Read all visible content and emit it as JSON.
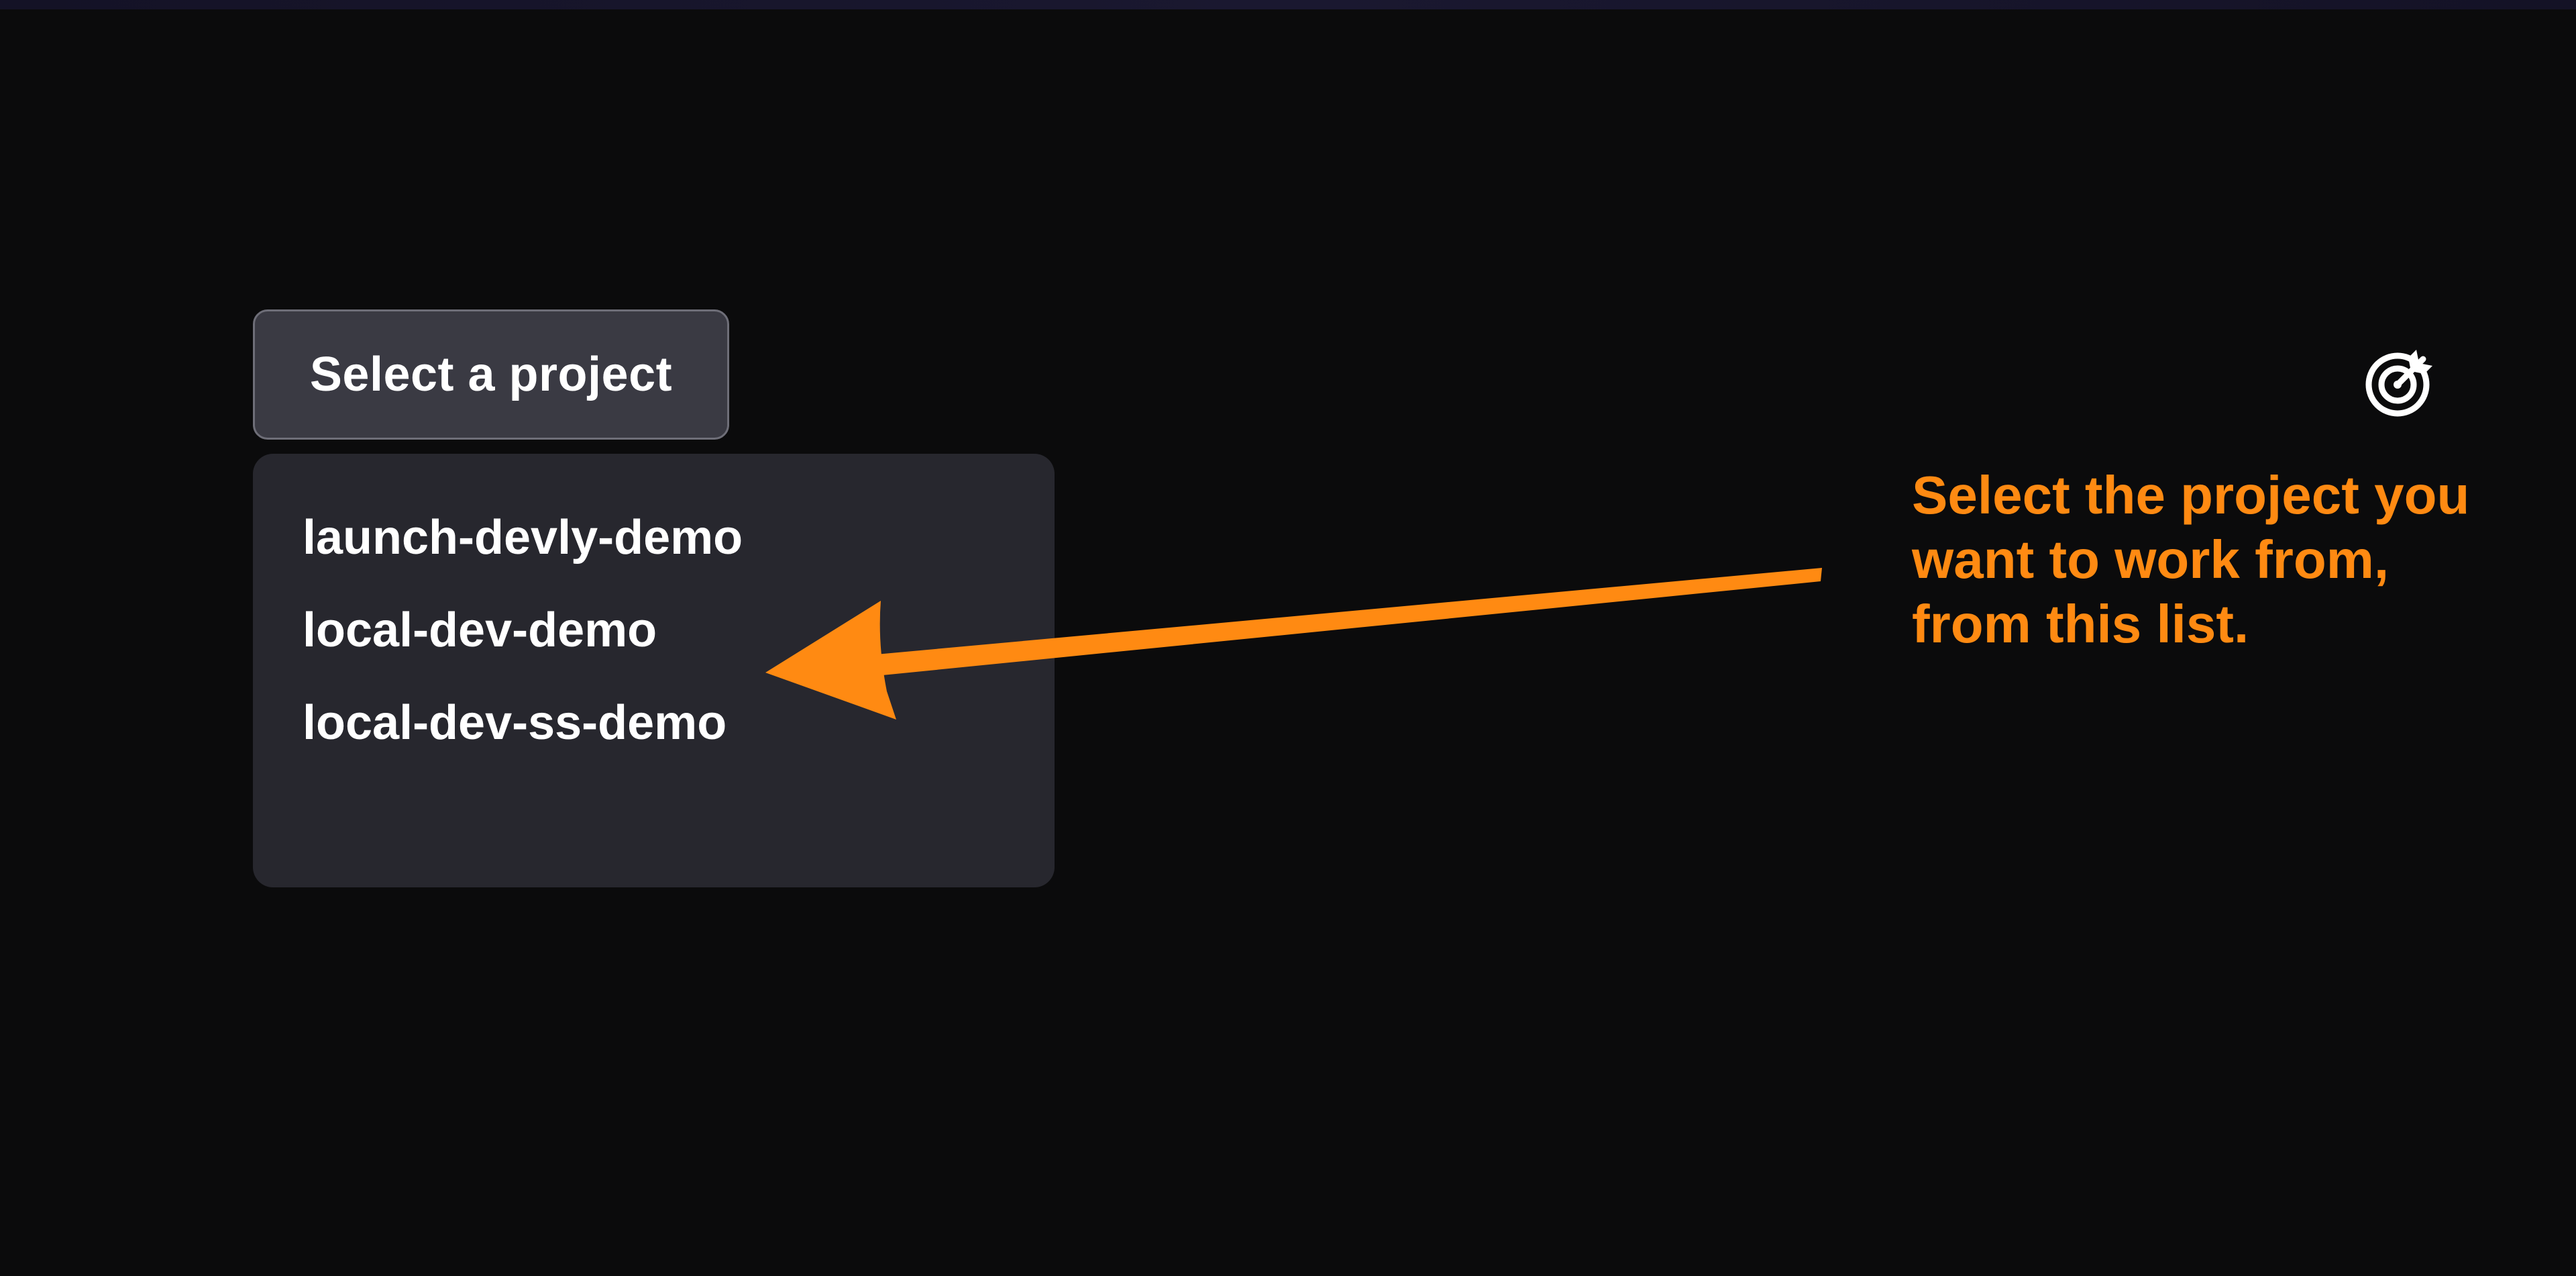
{
  "select": {
    "label": "Select a project"
  },
  "menu": {
    "items": [
      {
        "label": "launch-devly-demo"
      },
      {
        "label": "local-dev-demo"
      },
      {
        "label": "local-dev-ss-demo"
      }
    ]
  },
  "callout": {
    "text": "Select the project you want to work from, from this list."
  },
  "icons": {
    "target": "target-icon"
  },
  "colors": {
    "background": "#0b0b0c",
    "button_bg": "#3a3a43",
    "menu_bg": "#27272e",
    "accent": "#ff8a12",
    "text": "#ffffff"
  }
}
